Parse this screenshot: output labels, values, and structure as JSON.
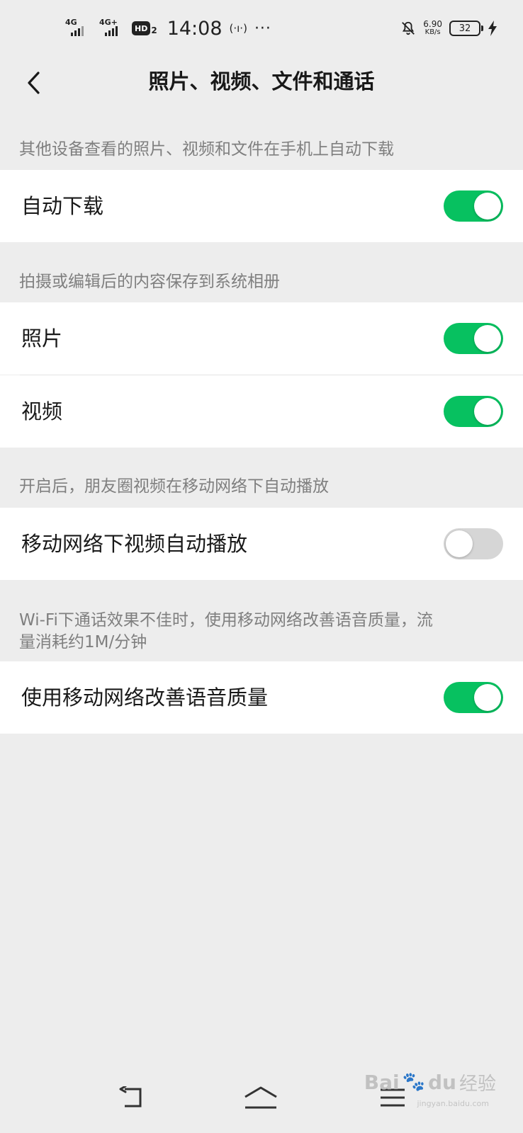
{
  "status_bar": {
    "sig1_tag": "4G",
    "sig2_tag": "4G+",
    "hd_label": "HD",
    "hd_sub": "2",
    "time": "14:08",
    "nfc_glyph": "(·ı·)",
    "more": "···",
    "speed_value": "6.90",
    "speed_unit": "KB/s",
    "battery_level": "32"
  },
  "header": {
    "title": "照片、视频、文件和通话"
  },
  "sections": {
    "auto_download": {
      "hint": "其他设备查看的照片、视频和文件在手机上自动下载",
      "label": "自动下载",
      "enabled": true
    },
    "save_to_album": {
      "hint": "拍摄或编辑后的内容保存到系统相册",
      "photo_label": "照片",
      "photo_enabled": true,
      "video_label": "视频",
      "video_enabled": true
    },
    "moments_autoplay": {
      "hint": "开启后，朋友圈视频在移动网络下自动播放",
      "label": "移动网络下视频自动播放",
      "enabled": false
    },
    "voice_quality": {
      "hint_line1": "Wi-Fi下通话效果不佳时，使用移动网络改善语音质量，流",
      "hint_line2": "量消耗约1M/分钟",
      "label": "使用移动网络改善语音质量",
      "enabled": true
    }
  },
  "watermark": {
    "brand": "Bai",
    "brand2": "du",
    "cn": "经验",
    "sub": "jingyan.baidu.com"
  },
  "colors": {
    "accent": "#07c160",
    "toggle_off": "#d6d6d6",
    "background": "#ededed"
  },
  "icons": {
    "back": "chevron-left-icon",
    "nav_back": "back-arrow-icon",
    "nav_home": "home-icon",
    "nav_menu": "menu-icon"
  }
}
